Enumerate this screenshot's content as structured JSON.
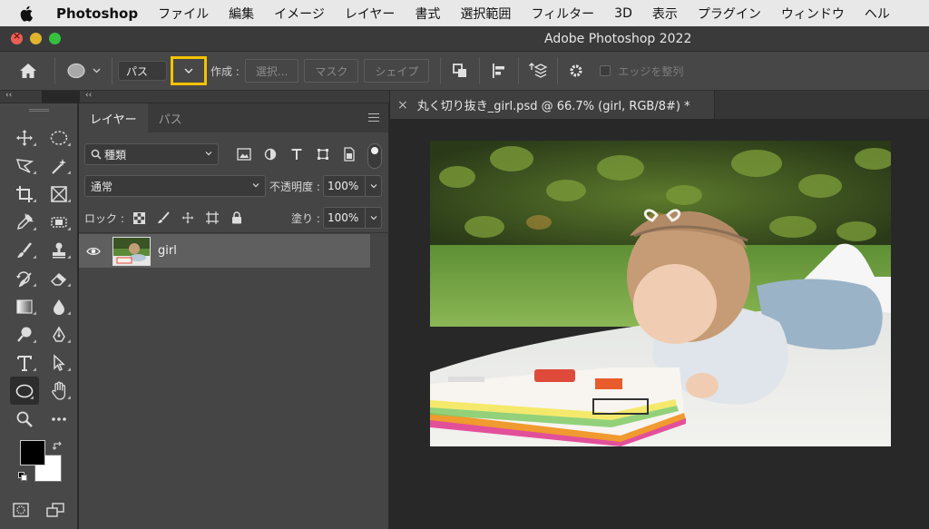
{
  "menubar": {
    "app": "Photoshop",
    "items": [
      "ファイル",
      "編集",
      "イメージ",
      "レイヤー",
      "書式",
      "選択範囲",
      "フィルター",
      "3D",
      "表示",
      "プラグイン",
      "ウィンドウ",
      "ヘル"
    ]
  },
  "window": {
    "title": "Adobe Photoshop 2022"
  },
  "options": {
    "mode_value": "パス",
    "create_label": "作成 :",
    "select_button": "選択...",
    "mask_button": "マスク",
    "shape_button": "シェイプ",
    "align_edges_label": "エッジを整列"
  },
  "strip": {
    "collapse_glyph": "‹‹"
  },
  "layers_panel": {
    "tabs": [
      "レイヤー",
      "パス"
    ],
    "filter_kind": "種類",
    "blend_mode": "通常",
    "opacity_label": "不透明度 :",
    "opacity_value": "100%",
    "lock_label": "ロック :",
    "fill_label": "塗り :",
    "fill_value": "100%",
    "layers": [
      {
        "name": "girl"
      }
    ]
  },
  "document": {
    "tab_close": "×",
    "tab_title": "丸く切り抜き_girl.psd @ 66.7% (girl, RGB/8#) *"
  },
  "colors": {
    "foreground": "#000000",
    "background": "#ffffff",
    "highlight": "#f3c300"
  }
}
